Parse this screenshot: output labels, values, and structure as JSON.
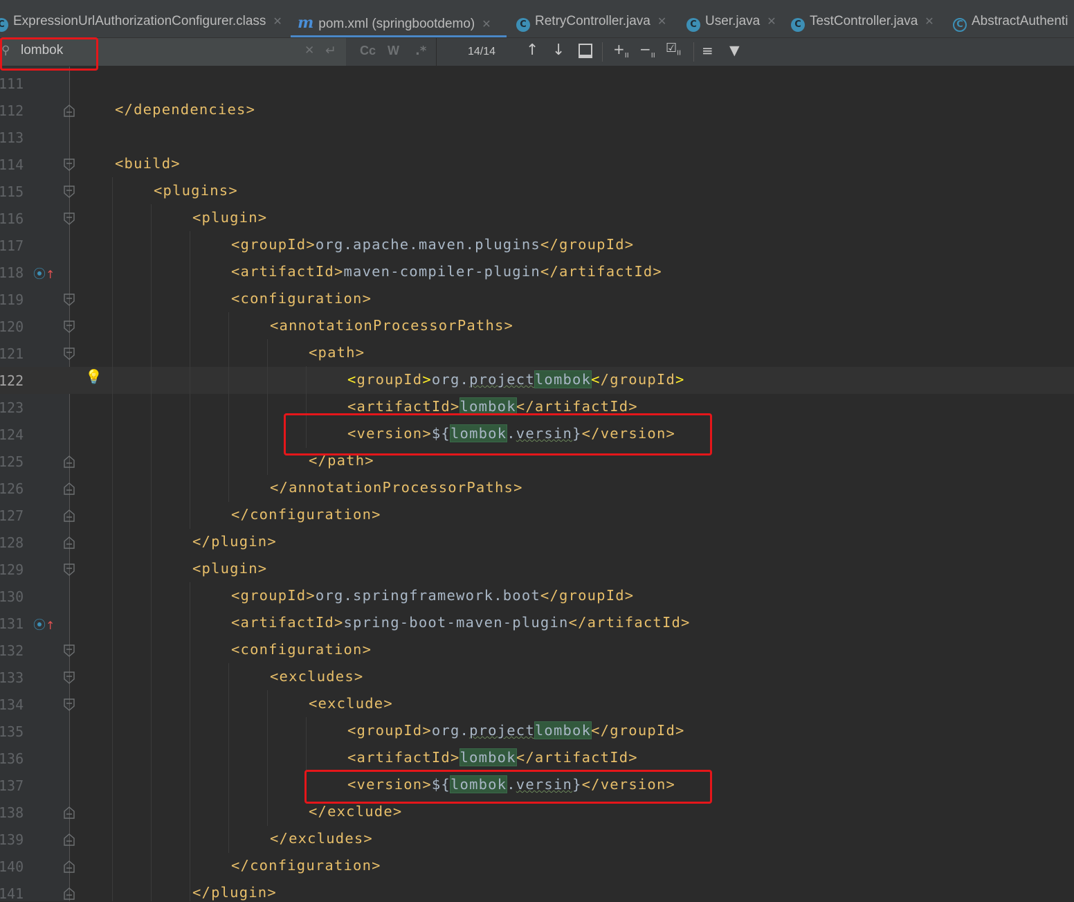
{
  "tabs": [
    {
      "label": "ExpressionUrlAuthorizationConfigurer.class",
      "icon": "class-icon",
      "closable": true
    },
    {
      "label": "pom.xml (springbootdemo)",
      "icon": "maven-icon",
      "closable": true,
      "active": true
    },
    {
      "label": "RetryController.java",
      "icon": "class-icon",
      "closable": true
    },
    {
      "label": "User.java",
      "icon": "class-icon",
      "closable": true
    },
    {
      "label": "TestController.java",
      "icon": "class-icon",
      "closable": true
    },
    {
      "label": "AbstractAuthenti",
      "icon": "abstract-class-icon",
      "closable": false
    }
  ],
  "find": {
    "query": "lombok",
    "match_count": "14/14",
    "case_label": "Cc",
    "word_label": "W",
    "regex_label": ".*"
  },
  "gutter": {
    "line_numbers": [
      "111",
      "112",
      "113",
      "114",
      "115",
      "116",
      "117",
      "118",
      "119",
      "120",
      "121",
      "122",
      "123",
      "124",
      "125",
      "126",
      "127",
      "128",
      "129",
      "130",
      "131",
      "132",
      "133",
      "134",
      "135",
      "136",
      "137",
      "138",
      "139",
      "140",
      "141"
    ],
    "current_line": "122"
  },
  "code_lines": [
    "",
    "</dependencies>",
    "",
    "<build>",
    "<plugins>",
    "<plugin>",
    "<groupId>org.apache.maven.plugins</groupId>",
    "<artifactId>maven-compiler-plugin</artifactId>",
    "<configuration>",
    "<annotationProcessorPaths>",
    "<path>",
    "<groupId>org.projectlombok</groupId>",
    "<artifactId>lombok</artifactId>",
    "<version>${lombok.versin}</version>",
    "</path>",
    "</annotationProcessorPaths>",
    "</configuration>",
    "</plugin>",
    "<plugin>",
    "<groupId>org.springframework.boot</groupId>",
    "<artifactId>spring-boot-maven-plugin</artifactId>",
    "<configuration>",
    "<excludes>",
    "<exclude>",
    "<groupId>org.projectlombok</groupId>",
    "<artifactId>lombok</artifactId>",
    "<version>${lombok.versin}</version>",
    "</exclude>",
    "</excludes>",
    "</configuration>",
    "</plugin>"
  ],
  "colors": {
    "editor_bg": "#2b2b2b",
    "tag": "#e8bf6a",
    "text": "#a9b7c6",
    "search_highlight": "#32593d",
    "annotation_red": "#e5161a"
  }
}
